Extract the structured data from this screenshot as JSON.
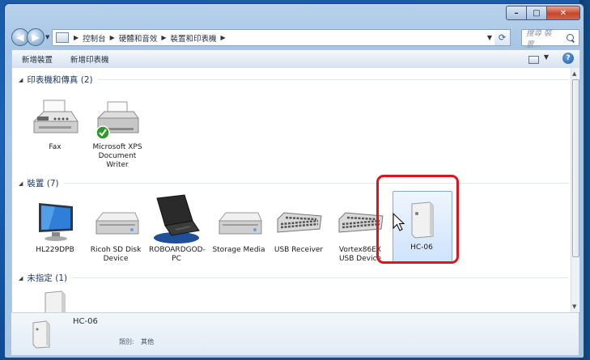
{
  "window": {
    "caption": {
      "minimize": "–",
      "maximize": "□",
      "close": "✕"
    }
  },
  "nav": {
    "back": "◀",
    "forward": "▶",
    "breadcrumb": [
      "控制台",
      "硬體和音效",
      "裝置和印表機"
    ],
    "search_placeholder": "搜尋 裝置..."
  },
  "toolbar": {
    "add_device": "新增裝置",
    "add_printer": "新增印表機",
    "help": "?"
  },
  "groups": [
    {
      "title": "印表機和傳真 (2)",
      "items": [
        {
          "label": "Fax",
          "icon": "fax-icon"
        },
        {
          "label": "Microsoft XPS Document Writer",
          "icon": "printer-icon"
        }
      ]
    },
    {
      "title": "裝置 (7)",
      "items": [
        {
          "label": "HL229DPB",
          "icon": "monitor-icon"
        },
        {
          "label": "Ricoh SD Disk Device",
          "icon": "drive-icon"
        },
        {
          "label": "ROBOARDGOD-PC",
          "icon": "laptop-icon"
        },
        {
          "label": "Storage Media",
          "icon": "drive-icon"
        },
        {
          "label": "USB Receiver",
          "icon": "keyboard-icon"
        },
        {
          "label": "Vortex86EX USB Device",
          "icon": "keyboard-icon"
        },
        {
          "label": "HC-06",
          "icon": "generic-device-icon",
          "selected": true
        }
      ]
    },
    {
      "title": "未指定 (1)",
      "items": [
        {
          "label": "",
          "icon": "generic-device-icon"
        }
      ]
    }
  ],
  "details": {
    "name": "HC-06",
    "category_label": "類別:",
    "category_value": "其他"
  },
  "colors": {
    "highlight": "#e0131c",
    "selection": "#cfe3fb"
  }
}
